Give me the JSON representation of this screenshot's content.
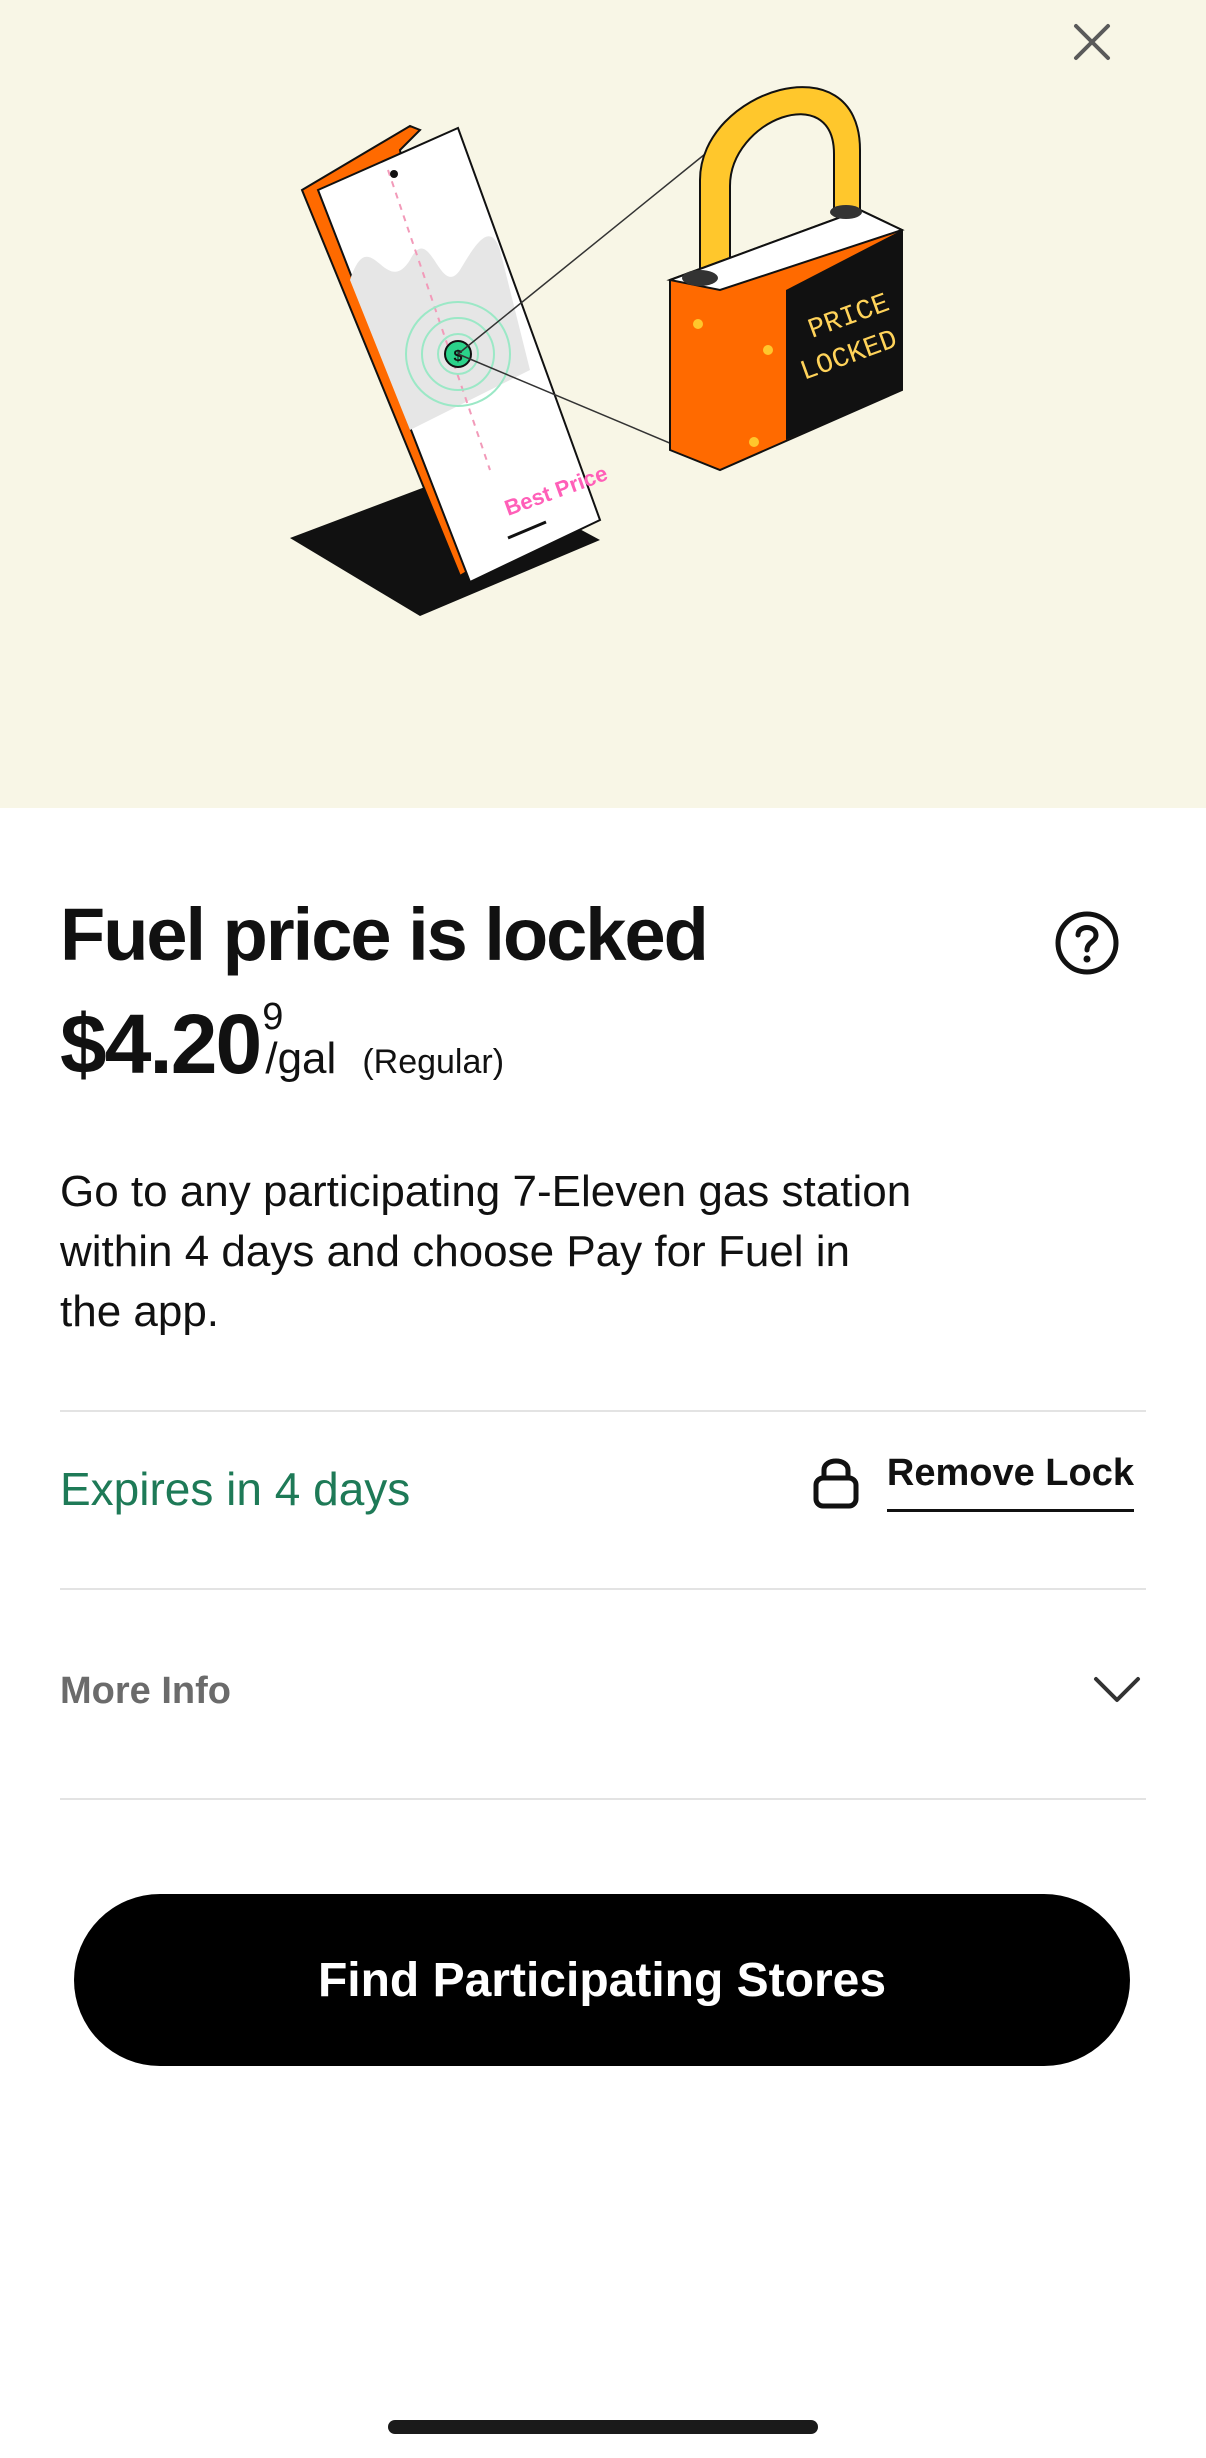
{
  "header": {
    "close_icon": "close-icon"
  },
  "illustration": {
    "phone_label": "Best Price",
    "lock_label_line1": "PRICE",
    "lock_label_line2": "LOCKED",
    "coin_symbol": "$"
  },
  "main": {
    "title": "Fuel price is locked",
    "help_icon": "question-circle-icon",
    "price": {
      "amount": "$4.20",
      "fraction": "9",
      "unit": "/gal",
      "grade": "(Regular)"
    },
    "description": "Go to any participating 7-Eleven gas station within 4 days and choose Pay for Fuel in the app.",
    "expires_text": "Expires in 4 days",
    "remove_lock_label": "Remove Lock",
    "more_info_label": "More Info",
    "cta_label": "Find Participating Stores"
  },
  "colors": {
    "hero_bg": "#f8f6e6",
    "expires_green": "#1e7a57",
    "lock_orange": "#ff6a00",
    "shackle_yellow": "#ffc72c",
    "coin_green": "#2bd28a",
    "best_price_pink": "#ff5fb8"
  }
}
